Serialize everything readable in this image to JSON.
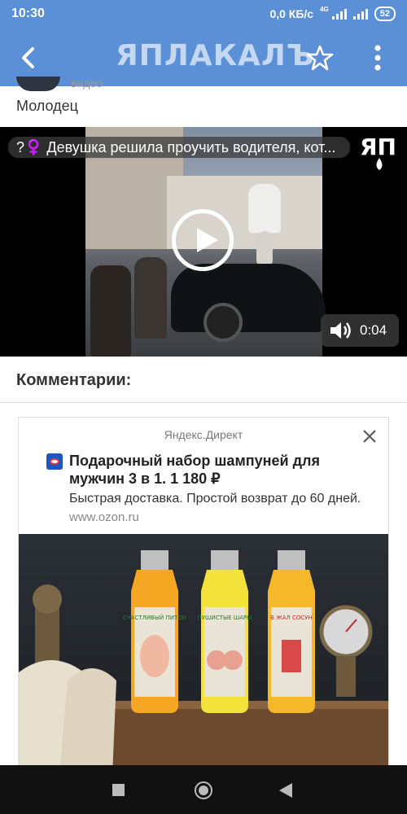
{
  "status_bar": {
    "time": "10:30",
    "network_speed": "0,0 КБ/с",
    "network_type": "4G",
    "battery": "52"
  },
  "app_bar": {
    "logo": "ЯПЛАКАЛЪ",
    "back_icon": "arrow-left-icon",
    "favorite_icon": "star-outline-icon",
    "menu_icon": "more-vertical-icon",
    "color": "#5b8fd6"
  },
  "post": {
    "top_partial_label": "видео",
    "author_line": "Молодец"
  },
  "video": {
    "title": "?♀️ Девушка решила проучить водителя, кот...",
    "logo": "ЯП",
    "duration": "0:04",
    "play_icon": "play-circle-icon",
    "volume_icon": "volume-icon"
  },
  "comments": {
    "heading": "Комментарии:"
  },
  "ad": {
    "source": "Яндекс.Директ",
    "title": "Подарочный набор шампуней для мужчин 3 в 1. 1 180 ₽",
    "description": "Быстрая доставка. Простой возврат до 60 дней.",
    "url": "www.ozon.ru",
    "close_icon": "close-icon",
    "image": {
      "bottles": [
        {
          "label": "СЧАСТЛИВЫЙ ПИТОН",
          "color": "#f5a623"
        },
        {
          "label": "ПУШИСТЫЕ ШАРЫ",
          "color": "#f3e23a"
        },
        {
          "label": "В ЖАЛ СОСУН",
          "color": "#f5b82b"
        }
      ]
    }
  },
  "nav_bar": {
    "recent_icon": "square-icon",
    "home_icon": "home-circle-icon",
    "back_icon": "triangle-back-icon"
  }
}
